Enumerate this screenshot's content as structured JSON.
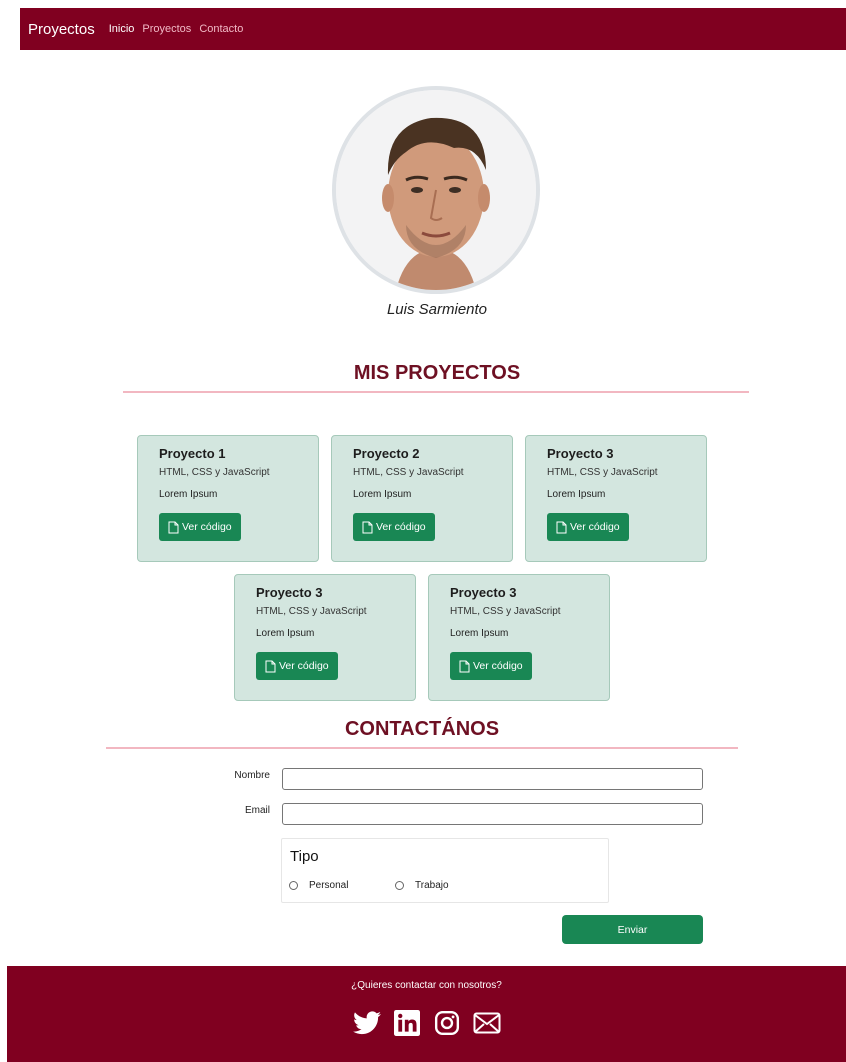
{
  "nav": {
    "brand": "Proyectos",
    "links": [
      "Inicio",
      "Proyectos",
      "Contacto"
    ],
    "active": "Inicio"
  },
  "profile": {
    "name": "Luis Sarmiento",
    "avatar_icon": "user-photo"
  },
  "projects_section": {
    "title": "MIS PROYECTOS",
    "cards": [
      {
        "title": "Proyecto 1",
        "subtitle": "HTML, CSS y JavaScript",
        "text": "Lorem Ipsum",
        "button": "Ver código"
      },
      {
        "title": "Proyecto 2",
        "subtitle": "HTML, CSS y JavaScript",
        "text": "Lorem Ipsum",
        "button": "Ver código"
      },
      {
        "title": "Proyecto 3",
        "subtitle": "HTML, CSS y JavaScript",
        "text": "Lorem Ipsum",
        "button": "Ver código"
      },
      {
        "title": "Proyecto 3",
        "subtitle": "HTML, CSS y JavaScript",
        "text": "Lorem Ipsum",
        "button": "Ver código"
      },
      {
        "title": "Proyecto 3",
        "subtitle": "HTML, CSS y JavaScript",
        "text": "Lorem Ipsum",
        "button": "Ver código"
      }
    ]
  },
  "contact_section": {
    "title": "CONTACTÁNOS",
    "name_label": "Nombre",
    "name_value": "",
    "email_label": "Email",
    "email_value": "",
    "type_legend": "Tipo",
    "options": [
      "Personal",
      "Trabajo"
    ],
    "submit_label": "Enviar"
  },
  "footer": {
    "text": "¿Quieres contactar con nosotros?",
    "icons": [
      "twitter-icon",
      "linkedin-icon",
      "instagram-icon",
      "mail-icon"
    ]
  },
  "colors": {
    "brand": "#800020",
    "heading": "#6e1023",
    "divider": "#f2b7c1",
    "card_bg": "#d3e6df",
    "button": "#198754"
  }
}
